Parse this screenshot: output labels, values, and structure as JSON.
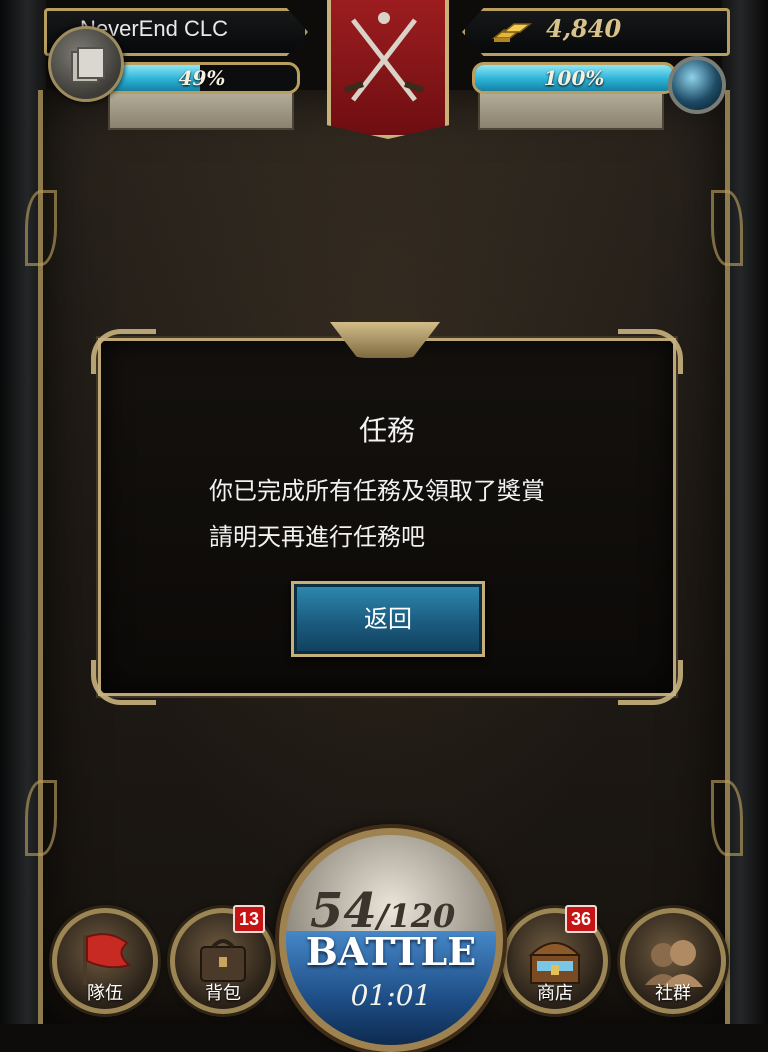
{
  "header": {
    "player_name": "NeverEnd CLC",
    "gold": "4,840",
    "left_bar": {
      "label": "49%",
      "value": 49
    },
    "right_bar": {
      "label": "100%",
      "value": 100
    }
  },
  "dialog": {
    "title": "任務",
    "line1": "你已完成所有任務及領取了獎賞",
    "line2": "請明天再進行任務吧",
    "button": "返回"
  },
  "battle": {
    "current": "54",
    "max": "/120",
    "label": "BATTLE",
    "timer": "01:01"
  },
  "nav": {
    "team": {
      "label": "隊伍"
    },
    "bag": {
      "label": "背包",
      "badge": "13"
    },
    "shop": {
      "label": "商店",
      "badge": "36"
    },
    "social": {
      "label": "社群"
    }
  },
  "colors": {
    "frame_gold": "#b89f60",
    "bar_cyan": "#2ab2d6",
    "badge_red": "#c41414",
    "crest_red": "#9c1d1f",
    "button_blue": "#1b5c80"
  },
  "icons": [
    "menu-icon",
    "gold-bars-icon",
    "crossed-swords-icon",
    "orb-icon",
    "red-flag-icon",
    "bag-icon",
    "treasure-chest-icon",
    "people-silhouette-icon"
  ]
}
